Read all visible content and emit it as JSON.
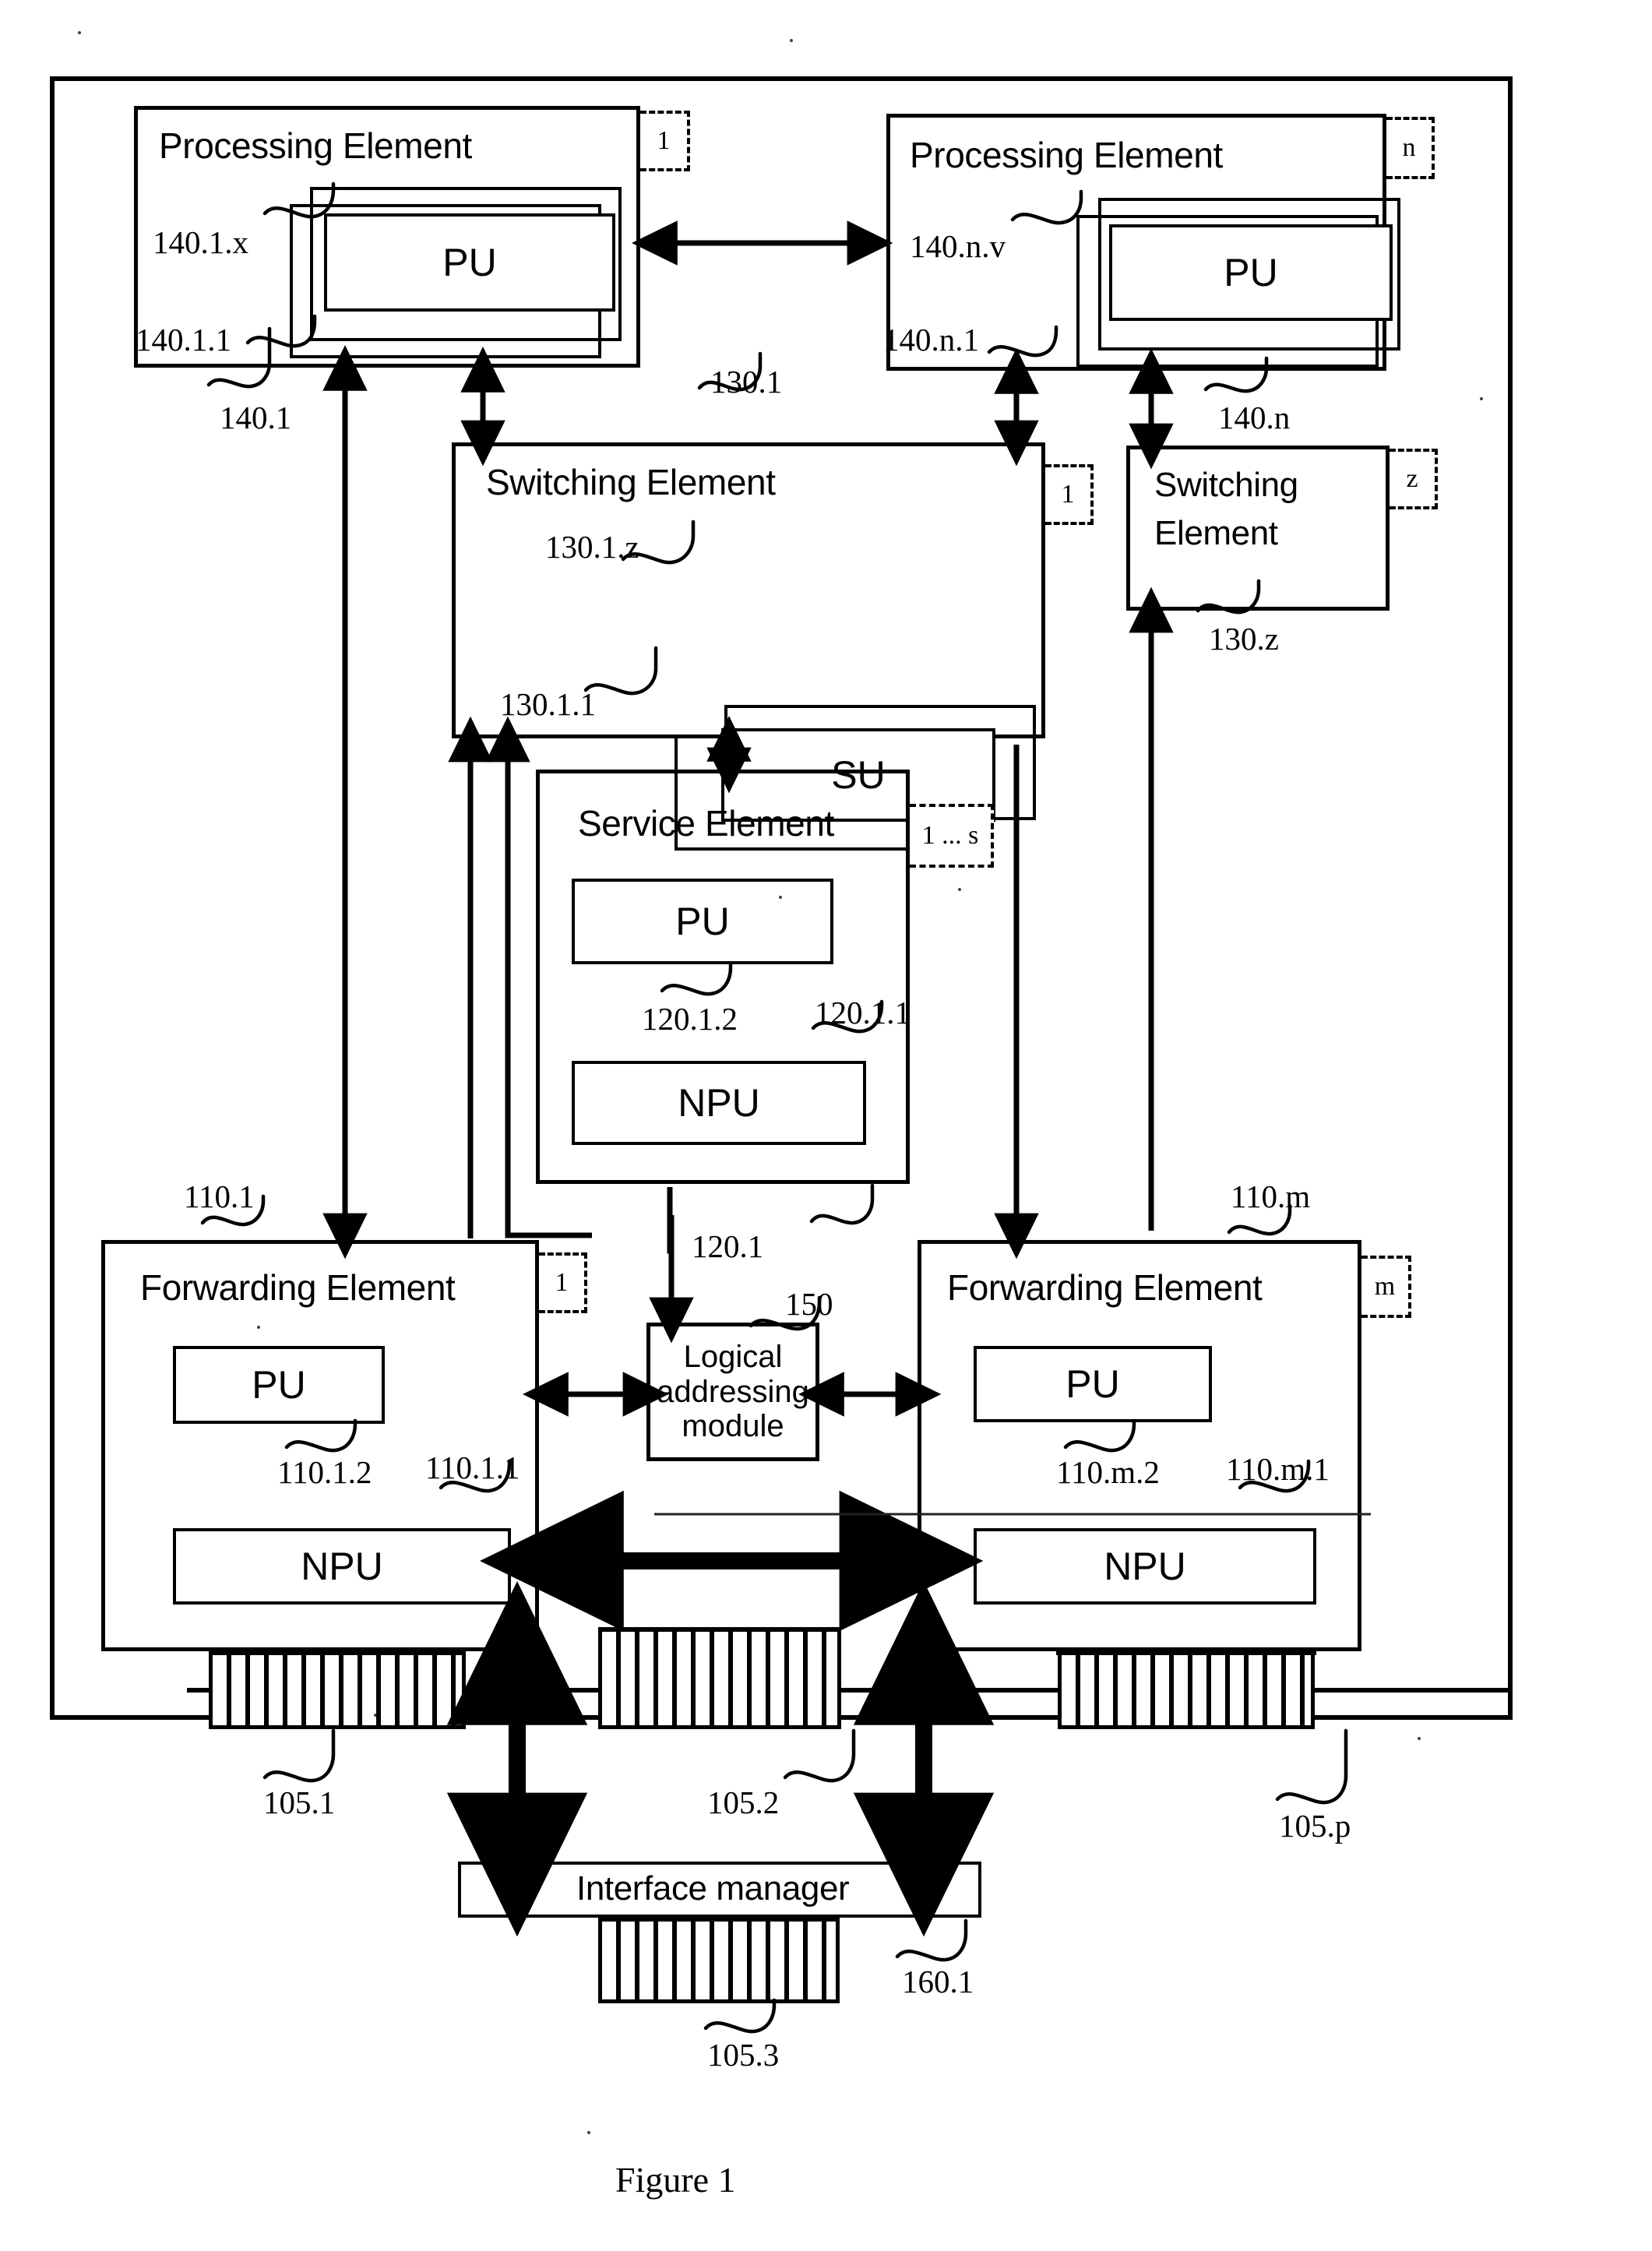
{
  "figure": {
    "caption": "Figure 1"
  },
  "outer_frame": {
    "name": "system-boundary"
  },
  "processing_elements": [
    {
      "title": "Processing Element",
      "badge": "1",
      "unit_label": "PU",
      "ref_outer": "140.1",
      "ref_unit_top": "140.1.x",
      "ref_unit_bottom": "140.1.1"
    },
    {
      "title": "Processing Element",
      "badge": "n",
      "unit_label": "PU",
      "ref_outer": "140.n",
      "ref_unit_top": "140.n.v",
      "ref_unit_bottom": "140.n.1"
    }
  ],
  "switching_elements": [
    {
      "title": "Switching Element",
      "badge": "1",
      "unit_label": "SU",
      "ref_outer": "130.1",
      "ref_unit_top": "130.1.z",
      "ref_unit_bottom": "130.1.1"
    },
    {
      "title_line1": "Switching",
      "title_line2": "Element",
      "badge": "z",
      "ref_outer": "130.z"
    }
  ],
  "service_element": {
    "title": "Service Element",
    "badge": "1 ... s",
    "pu_label": "PU",
    "npu_label": "NPU",
    "ref_outer": "120.1",
    "ref_pu": "120.1.2",
    "ref_npu": "120.1.1"
  },
  "forwarding_elements": [
    {
      "title": "Forwarding Element",
      "badge": "1",
      "pu_label": "PU",
      "npu_label": "NPU",
      "ref_outer": "110.1",
      "ref_pu": "110.1.2",
      "ref_npu": "110.1.1"
    },
    {
      "title": "Forwarding Element",
      "badge": "m",
      "pu_label": "PU",
      "npu_label": "NPU",
      "ref_outer": "110.m",
      "ref_pu": "110.m.2",
      "ref_npu": "110.m.1"
    }
  ],
  "logical_addressing_module": {
    "line1": "Logical",
    "line2": "addressing",
    "line3": "module",
    "ref": "150"
  },
  "interface_manager": {
    "title": "Interface manager",
    "ref": "160.1"
  },
  "port_groups": [
    {
      "ref": "105.1"
    },
    {
      "ref": "105.2"
    },
    {
      "ref": "105.p"
    },
    {
      "ref": "105.3"
    }
  ]
}
